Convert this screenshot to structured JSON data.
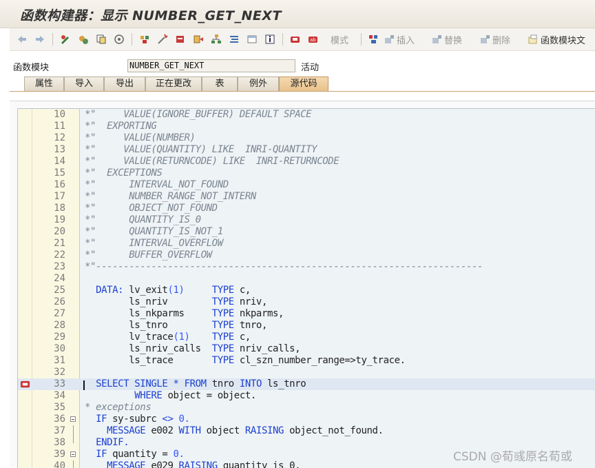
{
  "window": {
    "title": "函数构建器：显示 NUMBER_GET_NEXT"
  },
  "toolbar": {
    "buttons": {
      "mode": "模式",
      "insert": "插入",
      "replace": "替换",
      "delete": "删除",
      "function_module_doc": "函数模块文"
    }
  },
  "module": {
    "label": "函数模块",
    "name": "NUMBER_GET_NEXT",
    "status": "活动"
  },
  "tabs": [
    "属性",
    "导入",
    "导出",
    "正在更改",
    "表",
    "例外",
    "源代码"
  ],
  "active_tab": "源代码",
  "editor": {
    "lines": [
      {
        "num": "10",
        "text": "*\"     VALUE(IGNORE_BUFFER) DEFAULT SPACE"
      },
      {
        "num": "11",
        "text": "*\"  EXPORTING"
      },
      {
        "num": "12",
        "text": "*\"     VALUE(NUMBER)"
      },
      {
        "num": "13",
        "text": "*\"     VALUE(QUANTITY) LIKE  INRI-QUANTITY"
      },
      {
        "num": "14",
        "text": "*\"     VALUE(RETURNCODE) LIKE  INRI-RETURNCODE"
      },
      {
        "num": "15",
        "text": "*\"  EXCEPTIONS"
      },
      {
        "num": "16",
        "text": "*\"      INTERVAL_NOT_FOUND"
      },
      {
        "num": "17",
        "text": "*\"      NUMBER_RANGE_NOT_INTERN"
      },
      {
        "num": "18",
        "text": "*\"      OBJECT_NOT_FOUND"
      },
      {
        "num": "19",
        "text": "*\"      QUANTITY_IS_0"
      },
      {
        "num": "20",
        "text": "*\"      QUANTITY_IS_NOT_1"
      },
      {
        "num": "21",
        "text": "*\"      INTERVAL_OVERFLOW"
      },
      {
        "num": "22",
        "text": "*\"      BUFFER_OVERFLOW"
      },
      {
        "num": "23",
        "text": "*\"----------------------------------------------------------------------"
      },
      {
        "num": "24",
        "text": ""
      },
      {
        "num": "25",
        "text": "  DATA: lv_exit(1)     TYPE c,"
      },
      {
        "num": "26",
        "text": "        ls_nriv        TYPE nriv,"
      },
      {
        "num": "27",
        "text": "        ls_nkparms     TYPE nkparms,"
      },
      {
        "num": "28",
        "text": "        ls_tnro        TYPE tnro,"
      },
      {
        "num": "29",
        "text": "        lv_trace(1)    TYPE c,"
      },
      {
        "num": "30",
        "text": "        ls_nriv_calls  TYPE nriv_calls,"
      },
      {
        "num": "31",
        "text": "        ls_trace       TYPE cl_szn_number_range=>ty_trace."
      },
      {
        "num": "32",
        "text": ""
      },
      {
        "num": "33",
        "text": "  SELECT SINGLE * FROM tnro INTO ls_tnro"
      },
      {
        "num": "34",
        "text": "         WHERE object = object."
      },
      {
        "num": "35",
        "text": "* exceptions"
      },
      {
        "num": "36",
        "text": "  IF sy-subrc <> 0."
      },
      {
        "num": "37",
        "text": "    MESSAGE e002 WITH object RAISING object_not_found."
      },
      {
        "num": "38",
        "text": "  ENDIF."
      },
      {
        "num": "39",
        "text": "  IF quantity = 0."
      },
      {
        "num": "40",
        "text": "    MESSAGE e029 RAISING quantity_is_0."
      }
    ]
  },
  "watermark": "CSDN @荀彧原名荀或",
  "colors": {
    "keyword": "#1a3fd1",
    "comment": "#7a8590",
    "number": "#3355ff",
    "active_tab": "#e9c28c"
  }
}
